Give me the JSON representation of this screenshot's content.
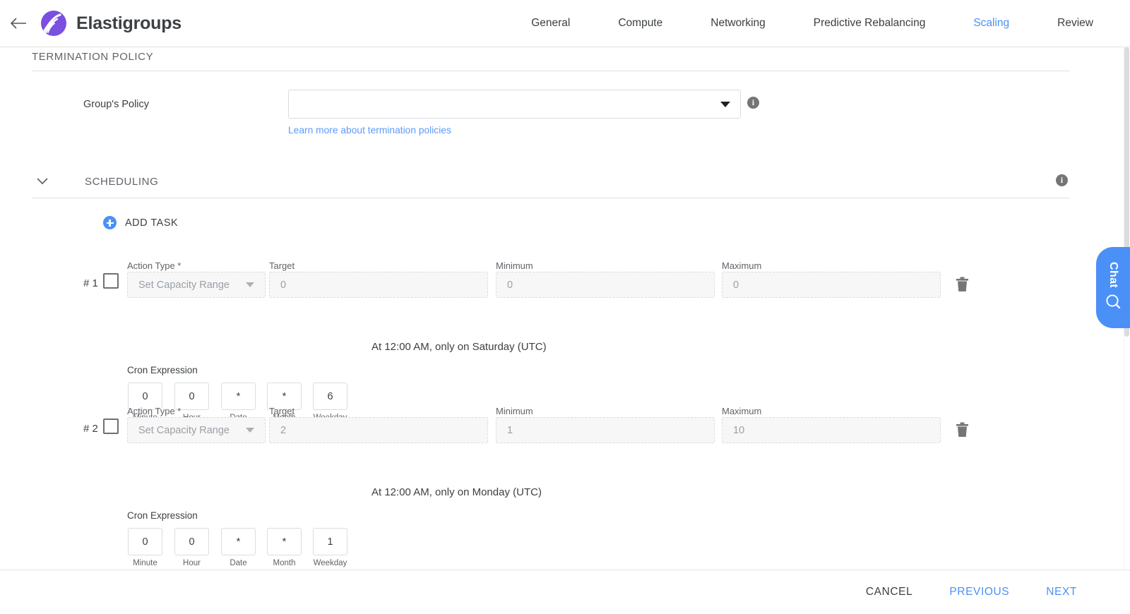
{
  "header": {
    "back_icon": "back-arrow-icon",
    "logo_icon": "elastigroups-logo",
    "brand": "Elastigroups",
    "nav": [
      {
        "label": "General",
        "active": false
      },
      {
        "label": "Compute",
        "active": false
      },
      {
        "label": "Networking",
        "active": false
      },
      {
        "label": "Predictive Rebalancing",
        "active": false
      },
      {
        "label": "Scaling",
        "active": true
      },
      {
        "label": "Review",
        "active": false
      }
    ]
  },
  "termination_policy": {
    "section_title": "TERMINATION POLICY",
    "group_policy_label": "Group's Policy",
    "group_policy_value": "",
    "group_policy_placeholder": "",
    "info_icon": "info-icon",
    "learn_more_link": "Learn more about termination policies"
  },
  "scheduling": {
    "section_title": "SCHEDULING",
    "chevron_icon": "chevron-down-icon",
    "info_icon": "info-icon",
    "add_task_label": "ADD TASK",
    "add_task_icon": "plus-circle-icon",
    "labels": {
      "action_type": "Action Type *",
      "target": "Target",
      "minimum": "Minimum",
      "maximum": "Maximum",
      "cron_expression": "Cron Expression",
      "minute": "Minute",
      "hour": "Hour",
      "date": "Date",
      "month": "Month",
      "weekday": "Weekday"
    },
    "tasks": [
      {
        "index": "# 1",
        "checked": false,
        "action_type": "Set Capacity Range",
        "target": "0",
        "minimum": "0",
        "maximum": "0",
        "cron": {
          "minute": "0",
          "hour": "0",
          "date": "*",
          "month": "*",
          "weekday": "6"
        },
        "cron_description": "At 12:00 AM, only on Saturday (UTC)",
        "delete_icon": "trash-icon"
      },
      {
        "index": "# 2",
        "checked": false,
        "action_type": "Set Capacity Range",
        "target": "2",
        "minimum": "1",
        "maximum": "10",
        "cron": {
          "minute": "0",
          "hour": "0",
          "date": "*",
          "month": "*",
          "weekday": "1"
        },
        "cron_description": "At 12:00 AM, only on Monday (UTC)",
        "delete_icon": "trash-icon"
      }
    ]
  },
  "footer": {
    "cancel": "CANCEL",
    "previous": "PREVIOUS",
    "next": "NEXT"
  },
  "chat_widget": {
    "label": "Chat",
    "icon": "chat-bubble-icon"
  },
  "colors": {
    "accent_blue": "#4a90f7",
    "link_blue": "#5b9bf8",
    "brand_purple": "#7b4fe0",
    "text_dark": "#3c4043",
    "text_muted": "#5f6368",
    "disabled_text": "#9aa0a6"
  }
}
